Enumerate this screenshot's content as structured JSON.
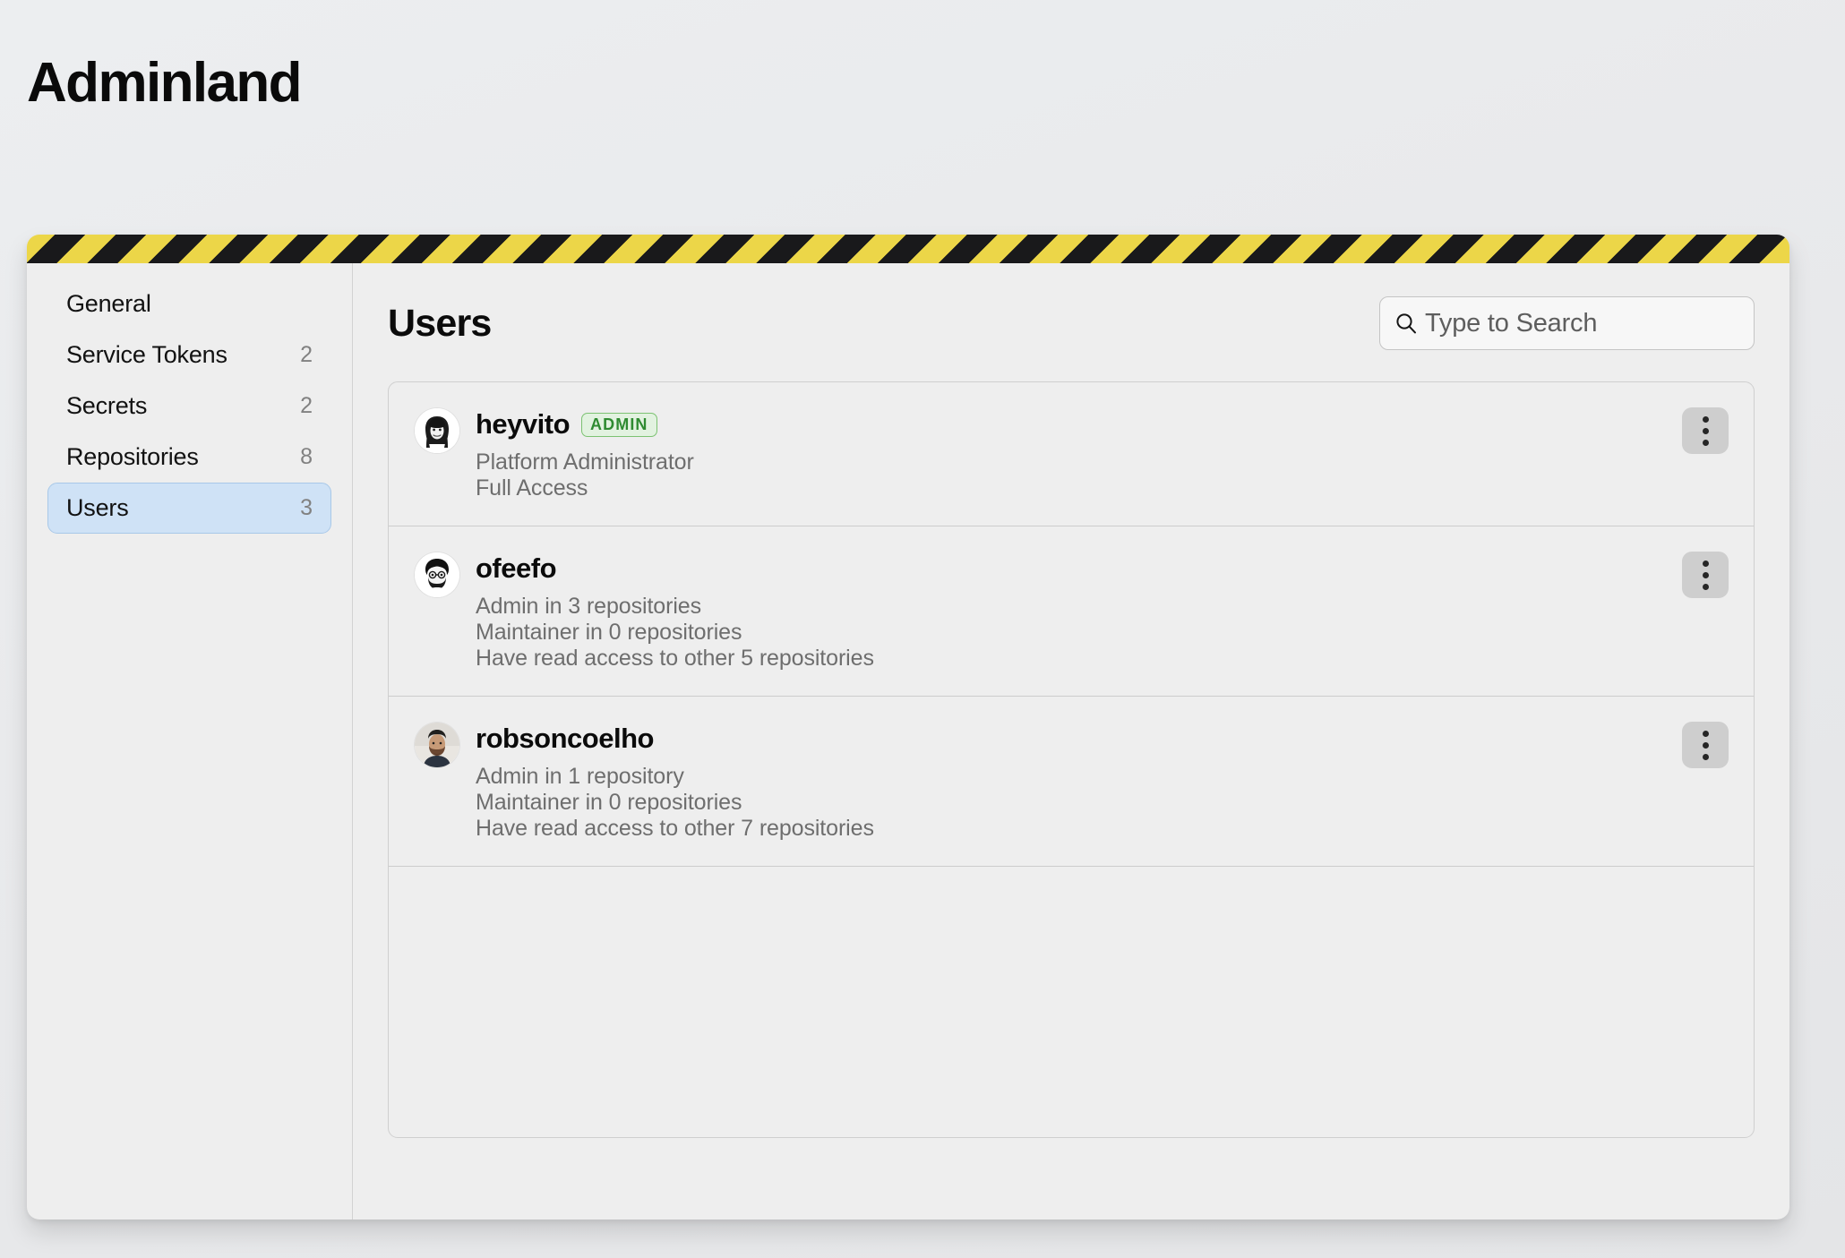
{
  "app": {
    "title": "Adminland"
  },
  "sidebar": {
    "items": [
      {
        "label": "General",
        "count": "",
        "active": false
      },
      {
        "label": "Service Tokens",
        "count": "2",
        "active": false
      },
      {
        "label": "Secrets",
        "count": "2",
        "active": false
      },
      {
        "label": "Repositories",
        "count": "8",
        "active": false
      },
      {
        "label": "Users",
        "count": "3",
        "active": true
      }
    ]
  },
  "content": {
    "title": "Users",
    "search": {
      "placeholder": "Type to Search",
      "value": "",
      "icon": "search-icon"
    },
    "users": [
      {
        "name": "heyvito",
        "badge": "ADMIN",
        "avatar": "heyvito-avatar",
        "meta": [
          "Platform Administrator",
          "Full Access"
        ],
        "menu_icon": "kebab-menu-icon"
      },
      {
        "name": "ofeefo",
        "badge": "",
        "avatar": "ofeefo-avatar",
        "meta": [
          "Admin in 3 repositories",
          "Maintainer in 0 repositories",
          "Have read access to other 5 repositories"
        ],
        "menu_icon": "kebab-menu-icon"
      },
      {
        "name": "robsoncoelho",
        "badge": "",
        "avatar": "robsoncoelho-avatar",
        "meta": [
          "Admin in 1 repository",
          "Maintainer in 0 repositories",
          "Have read access to other 7 repositories"
        ],
        "menu_icon": "kebab-menu-icon"
      }
    ]
  },
  "colors": {
    "page_bg": "#eceef0",
    "window_bg": "#eeeeee",
    "hazard_yellow": "#ecd648",
    "hazard_black": "#19191b",
    "active_nav_bg": "#cfe2f6",
    "active_nav_border": "#a8c8e8",
    "badge_text": "#2f8b31",
    "badge_bg": "#e2f2e0",
    "badge_border": "#7cc272",
    "muted_text": "#6e6e6e",
    "divider": "#cccccc",
    "kebab_bg": "#cecece"
  }
}
